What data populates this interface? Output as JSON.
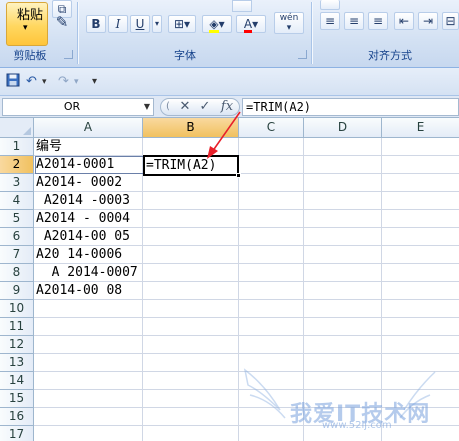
{
  "ribbon": {
    "clipboard": {
      "paste_label": "粘贴",
      "group_label": "剪贴板"
    },
    "font": {
      "bold": "B",
      "italic": "I",
      "underline": "U",
      "font_color": "A",
      "phonetic": "wén",
      "group_label": "字体"
    },
    "alignment": {
      "group_label": "对齐方式"
    }
  },
  "qat": {
    "save_icon": "save-icon",
    "undo_icon": "undo-icon",
    "redo_icon": "redo-icon"
  },
  "formula_bar": {
    "name_box": "OR",
    "cancel_glyph": "✕",
    "enter_glyph": "✓",
    "fx_label": "fx",
    "formula": "=TRIM(A2)"
  },
  "sheet": {
    "columns": [
      "A",
      "B",
      "C",
      "D",
      "E"
    ],
    "rows": [
      "1",
      "2",
      "3",
      "4",
      "5",
      "6",
      "7",
      "8",
      "9",
      "10",
      "11",
      "12",
      "13",
      "14",
      "15",
      "16",
      "17"
    ],
    "column_a": [
      "编号",
      "A2014-0001",
      "A2014- 0002",
      " A2014 -0003",
      "A2014 - 0004",
      " A2014-00 05",
      "A20 14-0006",
      "  A 2014-0007",
      "A2014-00 08"
    ],
    "b2_value": "=TRIM(A2)",
    "active_cell": "B2"
  },
  "watermark": {
    "text": "我爱IT技术网",
    "sub": "www.52ij.com"
  },
  "colors": {
    "selected_header": "#f1c15f",
    "gridline": "#d0d7e5",
    "arrow": "#e8202a",
    "ribbon_text": "#15428b"
  }
}
